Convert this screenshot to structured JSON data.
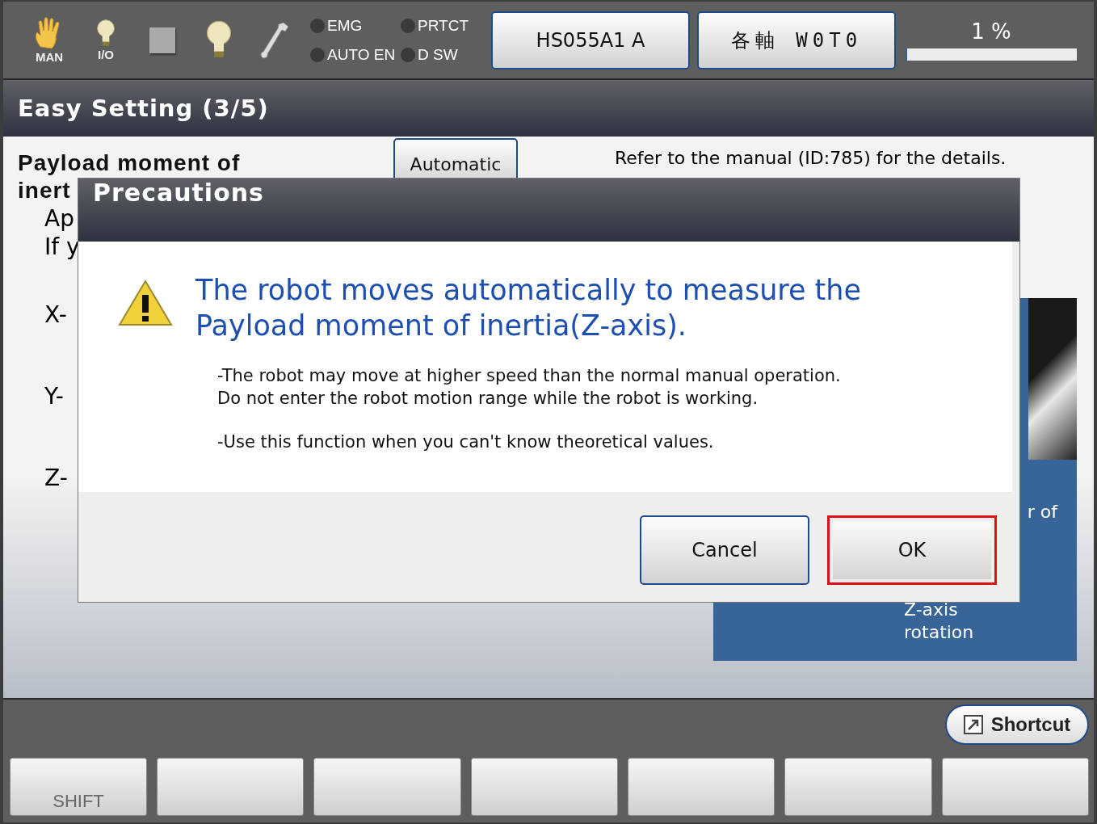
{
  "status_bar": {
    "mode_icons": [
      {
        "label": "MAN"
      },
      {
        "label": "I/O"
      }
    ],
    "lamps": [
      {
        "label": "EMG",
        "on": false
      },
      {
        "label": "PRTCT",
        "on": false
      },
      {
        "label": "AUTO EN",
        "on": false
      },
      {
        "label": "D SW",
        "on": false
      }
    ],
    "robot_button": "HS055A1 A",
    "axis_button": "各軸 W0T0",
    "speed": {
      "reading": "1 %",
      "level": 0.01
    }
  },
  "title": "Easy Setting (3/5)",
  "content": {
    "heading": "Payload moment of",
    "heading_cut": "inert",
    "lines": [
      "Ap",
      "If y"
    ],
    "axes": [
      "X-",
      "Y-",
      "Z-"
    ],
    "auto_button": "Automatic",
    "manual_note": "Refer to the manual (ID:785) for the details.",
    "panel_cut": "r of",
    "panel_caption": "Z-axis\nrotation"
  },
  "dialog": {
    "title": "Precautions",
    "message": "The robot moves automatically to measure the Payload moment of inertia(Z-axis).",
    "notes": [
      "-The robot may move at higher speed than the normal manual operation.\nDo not enter the robot motion range while the robot is working.",
      "-Use this function when you can't know theoretical values."
    ],
    "buttons": [
      {
        "label": "Cancel",
        "selected": false
      },
      {
        "label": "OK",
        "selected": true
      }
    ]
  },
  "bottom_bar": {
    "shortcut": "Shortcut",
    "function_keys": [
      {
        "kind": "labeled",
        "label": "SHIFT"
      },
      {
        "kind": "blank"
      },
      {
        "kind": "blank"
      },
      {
        "kind": "blank"
      },
      {
        "kind": "blank"
      },
      {
        "kind": "blank"
      },
      {
        "kind": "blank"
      }
    ]
  }
}
